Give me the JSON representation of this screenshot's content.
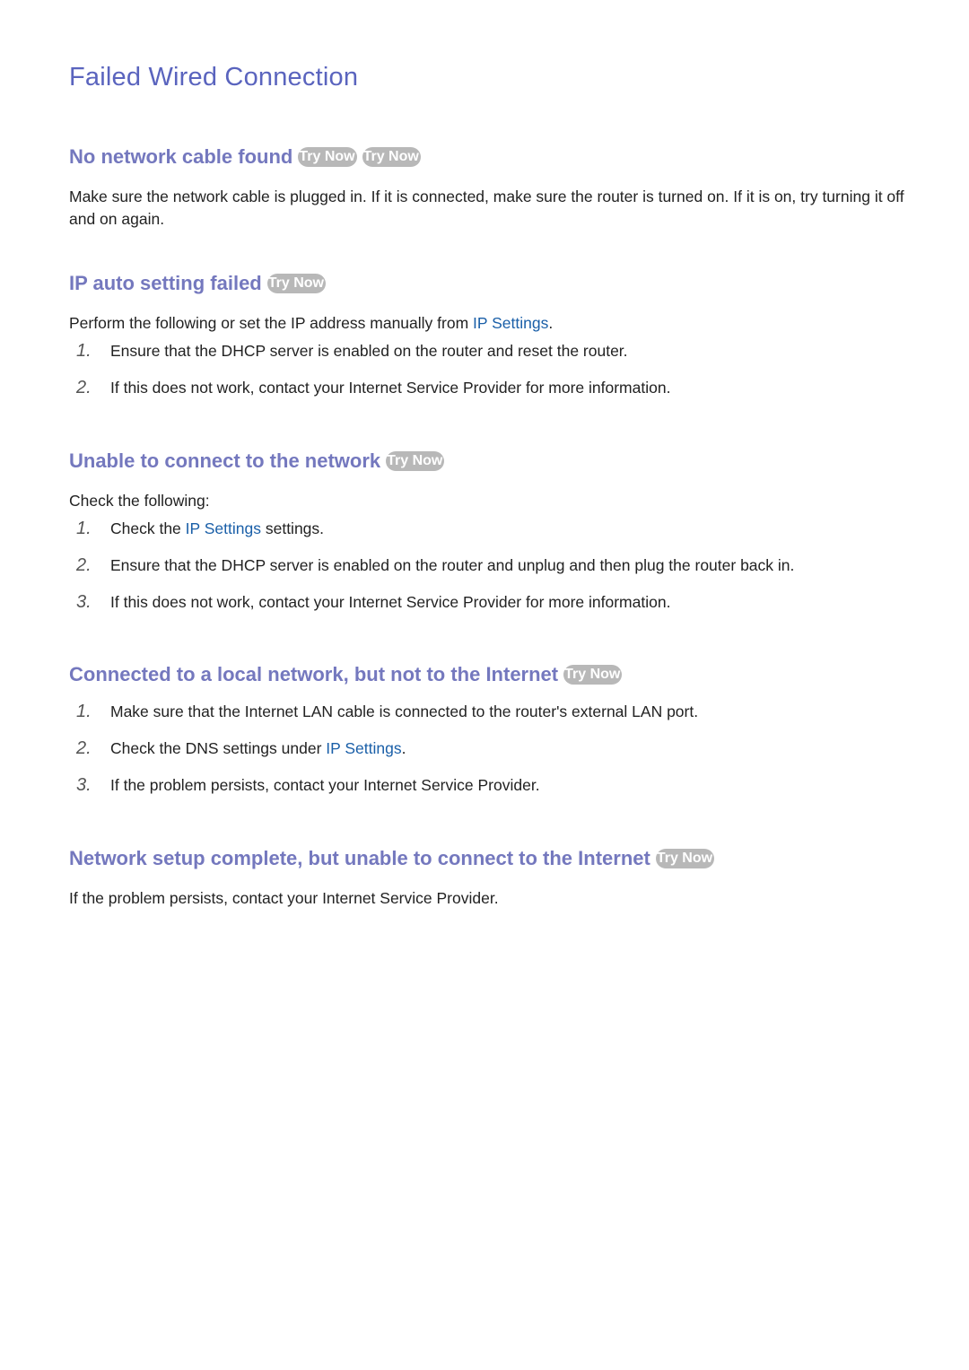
{
  "page": {
    "title": "Failed Wired Connection",
    "badge_label": "Try Now",
    "colors": {
      "title": "#5a64be",
      "heading": "#7478be",
      "link": "#1a5fa8",
      "badge_bg": "#b8b8b8",
      "badge_text": "#ffffff",
      "body_text": "#222222"
    }
  },
  "sections": [
    {
      "heading": "No network cable found",
      "badges": [
        "Try Now",
        "Try Now"
      ],
      "paragraph": "Make sure the network cable is plugged in. If it is connected, make sure the router is turned on. If it is on, try turning it off and on again."
    },
    {
      "heading": "IP auto setting failed",
      "badges": [
        "Try Now"
      ],
      "intro_before": "Perform the following or set the IP address manually from ",
      "intro_link": "IP Settings",
      "intro_after": ".",
      "items": [
        {
          "num": "1.",
          "text": "Ensure that the DHCP server is enabled on the router and reset the router."
        },
        {
          "num": "2.",
          "text": "If this does not work, contact your Internet Service Provider for more information."
        }
      ]
    },
    {
      "heading": "Unable to connect to the network",
      "badges": [
        "Try Now"
      ],
      "intro": "Check the following:",
      "items": [
        {
          "num": "1.",
          "before": "Check the ",
          "link": "IP Settings",
          "after": " settings."
        },
        {
          "num": "2.",
          "text": "Ensure that the DHCP server is enabled on the router and unplug and then plug the router back in."
        },
        {
          "num": "3.",
          "text": "If this does not work, contact your Internet Service Provider for more information."
        }
      ]
    },
    {
      "heading": "Connected to a local network, but not to the Internet",
      "badges": [
        "Try Now"
      ],
      "items": [
        {
          "num": "1.",
          "text": "Make sure that the Internet LAN cable is connected to the router's external LAN port."
        },
        {
          "num": "2.",
          "before": "Check the DNS settings under ",
          "link": "IP Settings",
          "after": "."
        },
        {
          "num": "3.",
          "text": "If the problem persists, contact your Internet Service Provider."
        }
      ]
    },
    {
      "heading": "Network setup complete, but unable to connect to the Internet",
      "badges": [
        "Try Now"
      ],
      "paragraph": "If the problem persists, contact your Internet Service Provider."
    }
  ]
}
